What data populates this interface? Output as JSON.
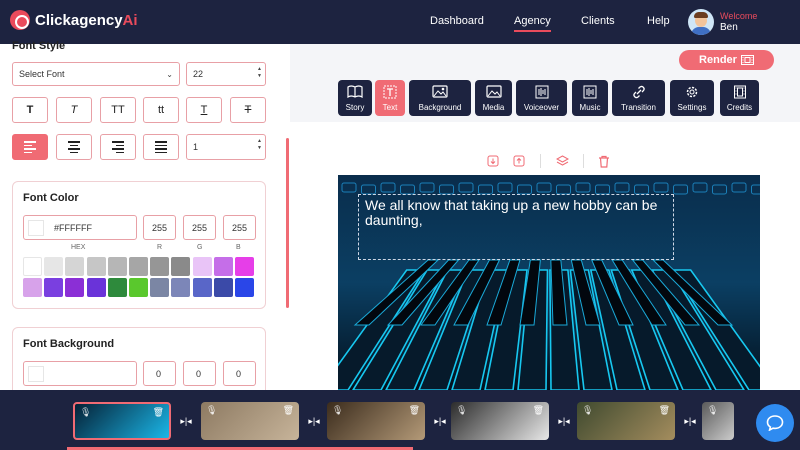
{
  "nav": {
    "brand_main": "Clickagency",
    "brand_ai": "Ai",
    "links": [
      "Dashboard",
      "Agency",
      "Clients",
      "Help"
    ],
    "active": "Agency",
    "welcome": "Welcome",
    "user": "Ben"
  },
  "font_style": {
    "title": "Font Style",
    "font_select": "Select Font",
    "font_size": "22",
    "style_buttons": [
      "T",
      "T",
      "TT",
      "tt",
      "T",
      "T"
    ],
    "line_height": "1"
  },
  "font_color": {
    "title": "Font Color",
    "hex": "#FFFFFF",
    "r": "255",
    "g": "255",
    "b": "255",
    "labels": [
      "HEX",
      "R",
      "G",
      "B"
    ],
    "palette": [
      "#ffffff",
      "#e6e6e6",
      "#d5d5d5",
      "#c6c6c6",
      "#b6b6b6",
      "#a6a6a6",
      "#969696",
      "#8a8a8a",
      "#e9c4f7",
      "#c56ee8",
      "#e63ee8",
      "#d7a2ea",
      "#7a3fe0",
      "#8b2fd6",
      "#6a33d9",
      "#2e8a3c",
      "#5ac82d",
      "#7b86a4",
      "#7c86b8",
      "#5966c8",
      "#3b4aa8",
      "#2a46e8"
    ]
  },
  "font_background": {
    "title": "Font Background",
    "hex": "",
    "r": "0",
    "g": "0",
    "b": "0"
  },
  "toolbar": {
    "render": "Render",
    "tools": [
      "Story",
      "Text",
      "Background",
      "Media",
      "Voiceover",
      "Music",
      "Transition",
      "Settings",
      "Credits"
    ],
    "active": "Text"
  },
  "canvas": {
    "caption": "We all know that taking up a new hobby can be daunting,"
  },
  "colors": {
    "accent": "#f06b74",
    "navy": "#1d2340",
    "chat": "#2f8bf0"
  }
}
